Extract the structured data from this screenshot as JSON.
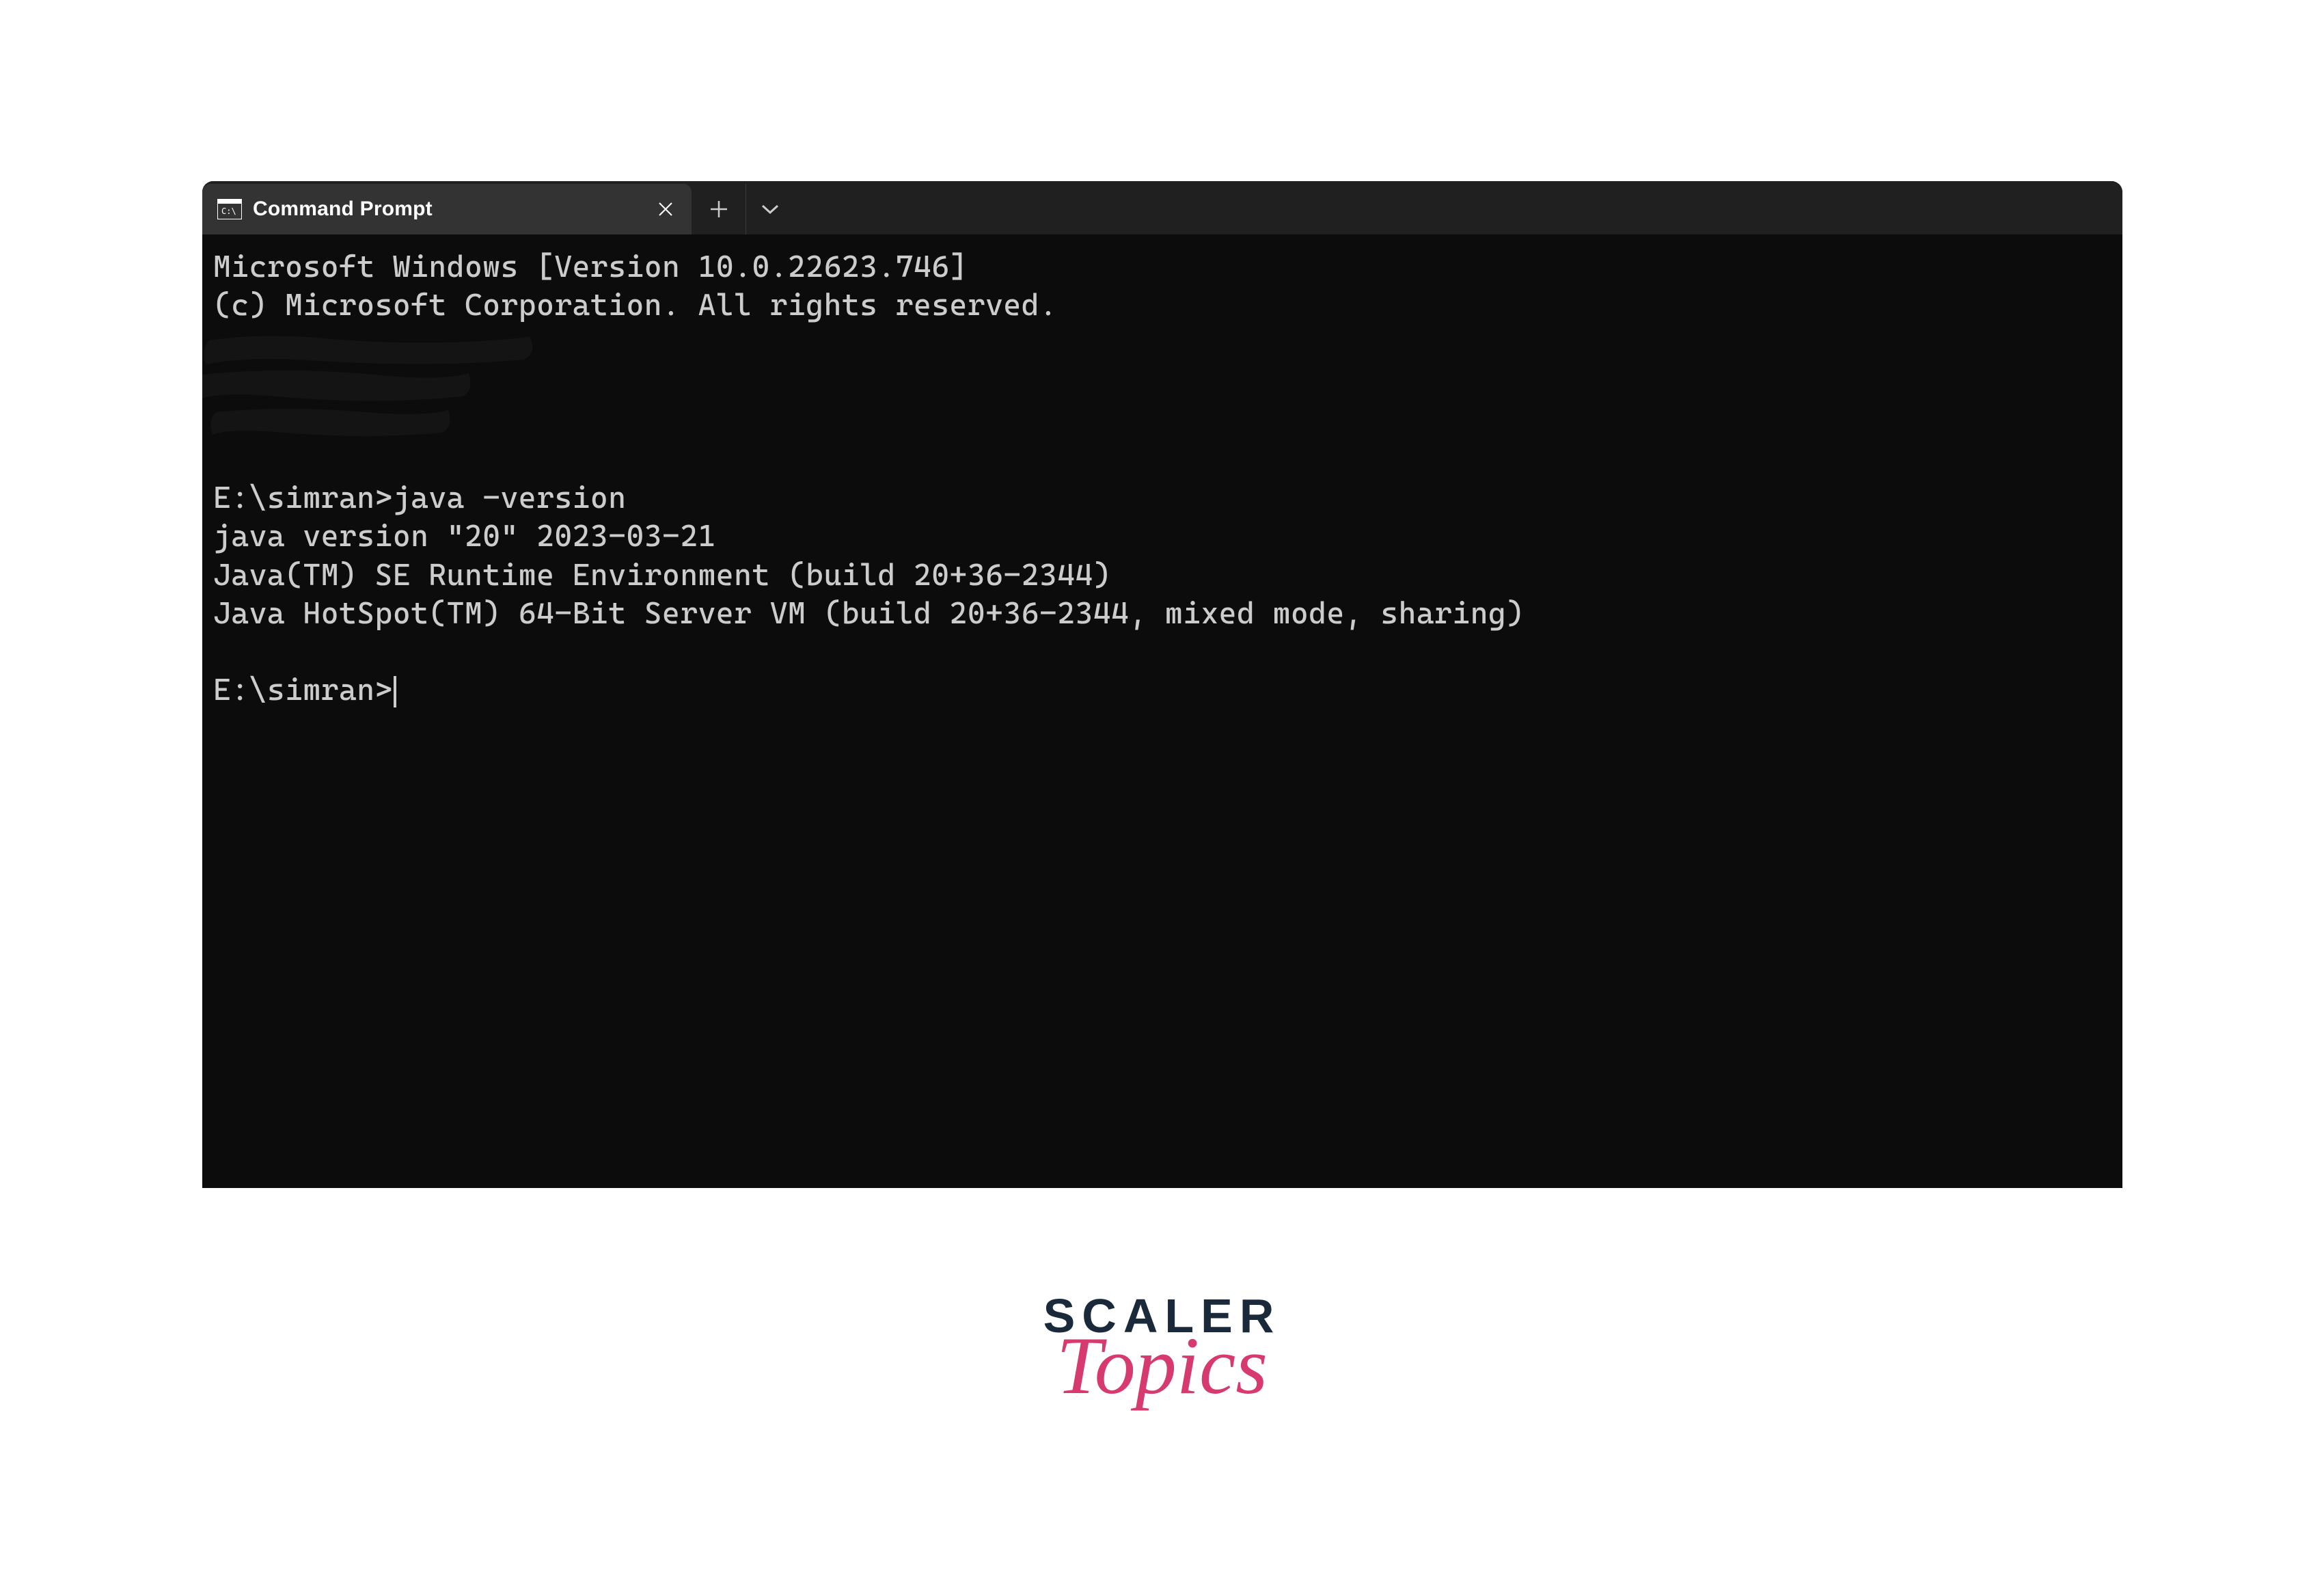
{
  "tab": {
    "title": "Command Prompt"
  },
  "terminal": {
    "lines": {
      "l1": "Microsoft Windows [Version 10.0.22623.746]",
      "l2": "(c) Microsoft Corporation. All rights reserved.",
      "l3": "",
      "l4": "",
      "l5": "",
      "l6": "",
      "l7": "E:\\simran>java -version",
      "l8": "java version \"20\" 2023-03-21",
      "l9": "Java(TM) SE Runtime Environment (build 20+36-2344)",
      "l10": "Java HotSpot(TM) 64-Bit Server VM (build 20+36-2344, mixed mode, sharing)",
      "l11": "",
      "l12": "E:\\simran>"
    }
  },
  "watermark": {
    "line1": "SCALER",
    "line2": "Topics"
  }
}
